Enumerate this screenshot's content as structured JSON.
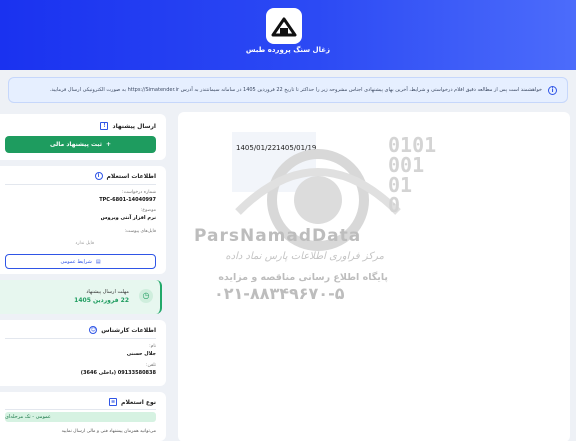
{
  "header": {
    "title": "زغال سنگ پرورده طبس",
    "logo_icon": "factory-icon",
    "gradient_start": "#1a32f0",
    "gradient_end": "#4c6cfb"
  },
  "notice": {
    "text": "خواهشمند است پس از مطالعه دقیق اقلام درخواستی و شرایط، آخرین بهای پیشنهادی اجناس مشروحه زیر را حداکثر تا تاریخ 22 فروردین 1405 در سامانه سیمانتندر به آدرس https://Simatender.ir به صورت الکترونیکی ارسال فرمایید."
  },
  "image_card": {
    "dates": [
      "1405/01/22",
      "1405/01/19"
    ],
    "watermark": {
      "brand": "ParsNamadData",
      "line1": "مرکز فراوری اطلاعات پارس نماد داده",
      "line2": "پایگاه اطلاع رسانی مناقصه و مزایده",
      "phone": "۰۲۱-۸۸۳۴۹۶۷۰-۵"
    }
  },
  "send_offer": {
    "title": "ارسال پیشنهاد",
    "title_icon": "warning-icon",
    "button_label": "ثبت پیشنهاد مالی",
    "button_color": "#1e9c5f"
  },
  "inquiry_info": {
    "title": "اطلاعات استعلام",
    "request_number_label": "شماره درخواست:",
    "request_number": "TPC-6801-14040997",
    "subject_label": "موضوع:",
    "subject": "نرم افزار آنتی ویروس",
    "attachments_label": "فایل‌های پیوست:",
    "no_file": "فایل ندارد",
    "general_terms_button": "شرایط عمومی"
  },
  "deadline": {
    "label": "مهلت ارسال پیشنهاد",
    "value": "22 فروردین 1405"
  },
  "expert_info": {
    "title": "اطلاعات کارشناس",
    "name_label": "نام:",
    "name": "جلال حسنی",
    "phone_label": "تلفن:",
    "phone": "09133580838 (داخلی 3646)"
  },
  "inquiry_type": {
    "title": "نوع استعلام",
    "badge": "عمومی - تک مرحله‌ای",
    "note": "می‌توانید همزمان پیشنهاد فنی و مالی ارسال نمایید"
  }
}
